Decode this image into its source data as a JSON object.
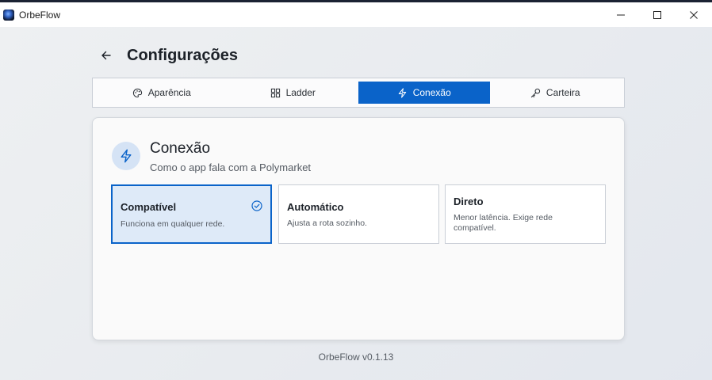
{
  "window": {
    "title": "OrbeFlow",
    "controls": {
      "minimize_icon": "minimize-icon",
      "maximize_icon": "maximize-icon",
      "close_icon": "close-icon"
    }
  },
  "header": {
    "back_icon": "arrow-left-icon",
    "title": "Configurações"
  },
  "tabs": [
    {
      "label": "Aparência",
      "icon": "palette-icon",
      "active": false
    },
    {
      "label": "Ladder",
      "icon": "grid-icon",
      "active": false
    },
    {
      "label": "Conexão",
      "icon": "lightning-icon",
      "active": true
    },
    {
      "label": "Carteira",
      "icon": "key-icon",
      "active": false
    }
  ],
  "section": {
    "icon": "lightning-icon",
    "title": "Conexão",
    "subtitle": "Como o app fala com a Polymarket"
  },
  "options": [
    {
      "title": "Compatível",
      "description": "Funciona em qualquer rede.",
      "selected": true
    },
    {
      "title": "Automático",
      "description": "Ajusta a rota sozinho.",
      "selected": false
    },
    {
      "title": "Direto",
      "description": "Menor latência. Exige rede compatível.",
      "selected": false
    }
  ],
  "footer": {
    "version": "OrbeFlow v0.1.13"
  },
  "colors": {
    "accent": "#0a63c9",
    "accent_soft": "#deeaf8",
    "icon_bg": "#d5e3f5"
  }
}
